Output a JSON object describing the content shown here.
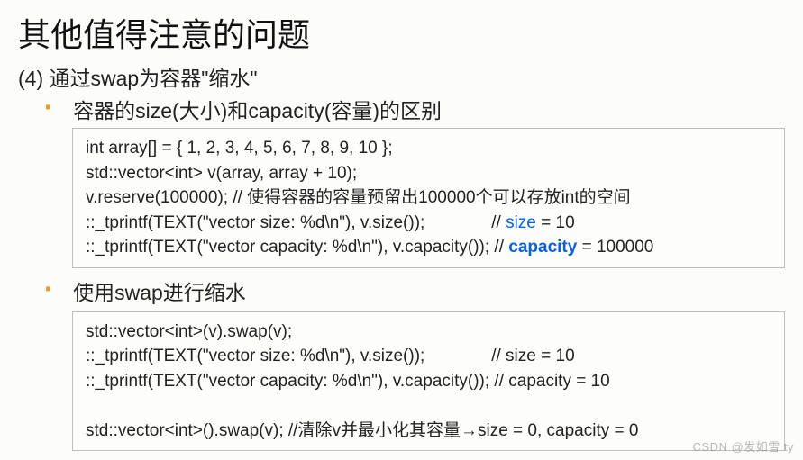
{
  "title": "其他值得注意的问题",
  "subheading": "(4) 通过swap为容器\"缩水\"",
  "bullet1": "容器的size(大小)和capacity(容量)的区别",
  "bullet2": "使用swap进行缩水",
  "code1": {
    "l1": "int array[] = { 1, 2, 3, 4, 5, 6, 7, 8, 9, 10 };",
    "l2": "std::vector<int> v(array, array + 10);",
    "l3": "v.reserve(100000); // 使得容器的容量预留出100000个可以存放int的空间",
    "l4a": "::_tprintf(TEXT(\"vector size: %d\\n\"), v.size());              // ",
    "l4c": "size",
    "l4b": " = 10",
    "l5a": "::_tprintf(TEXT(\"vector capacity: %d\\n\"), v.capacity()); // ",
    "l5c": "capacity",
    "l5b": " = 100000"
  },
  "code2": {
    "l1": "std::vector<int>(v).swap(v);",
    "l2": "::_tprintf(TEXT(\"vector size: %d\\n\"), v.size());              // size = 10",
    "l3": "::_tprintf(TEXT(\"vector capacity: %d\\n\"), v.capacity()); // capacity = 10",
    "l4": "",
    "l5a": "std::vector<int>().swap(v); //清除v并最小化其容量",
    "l5arrow": "→",
    "l5b": "size = 0, capacity = 0"
  },
  "watermark": "CSDN @发如雪 ty"
}
